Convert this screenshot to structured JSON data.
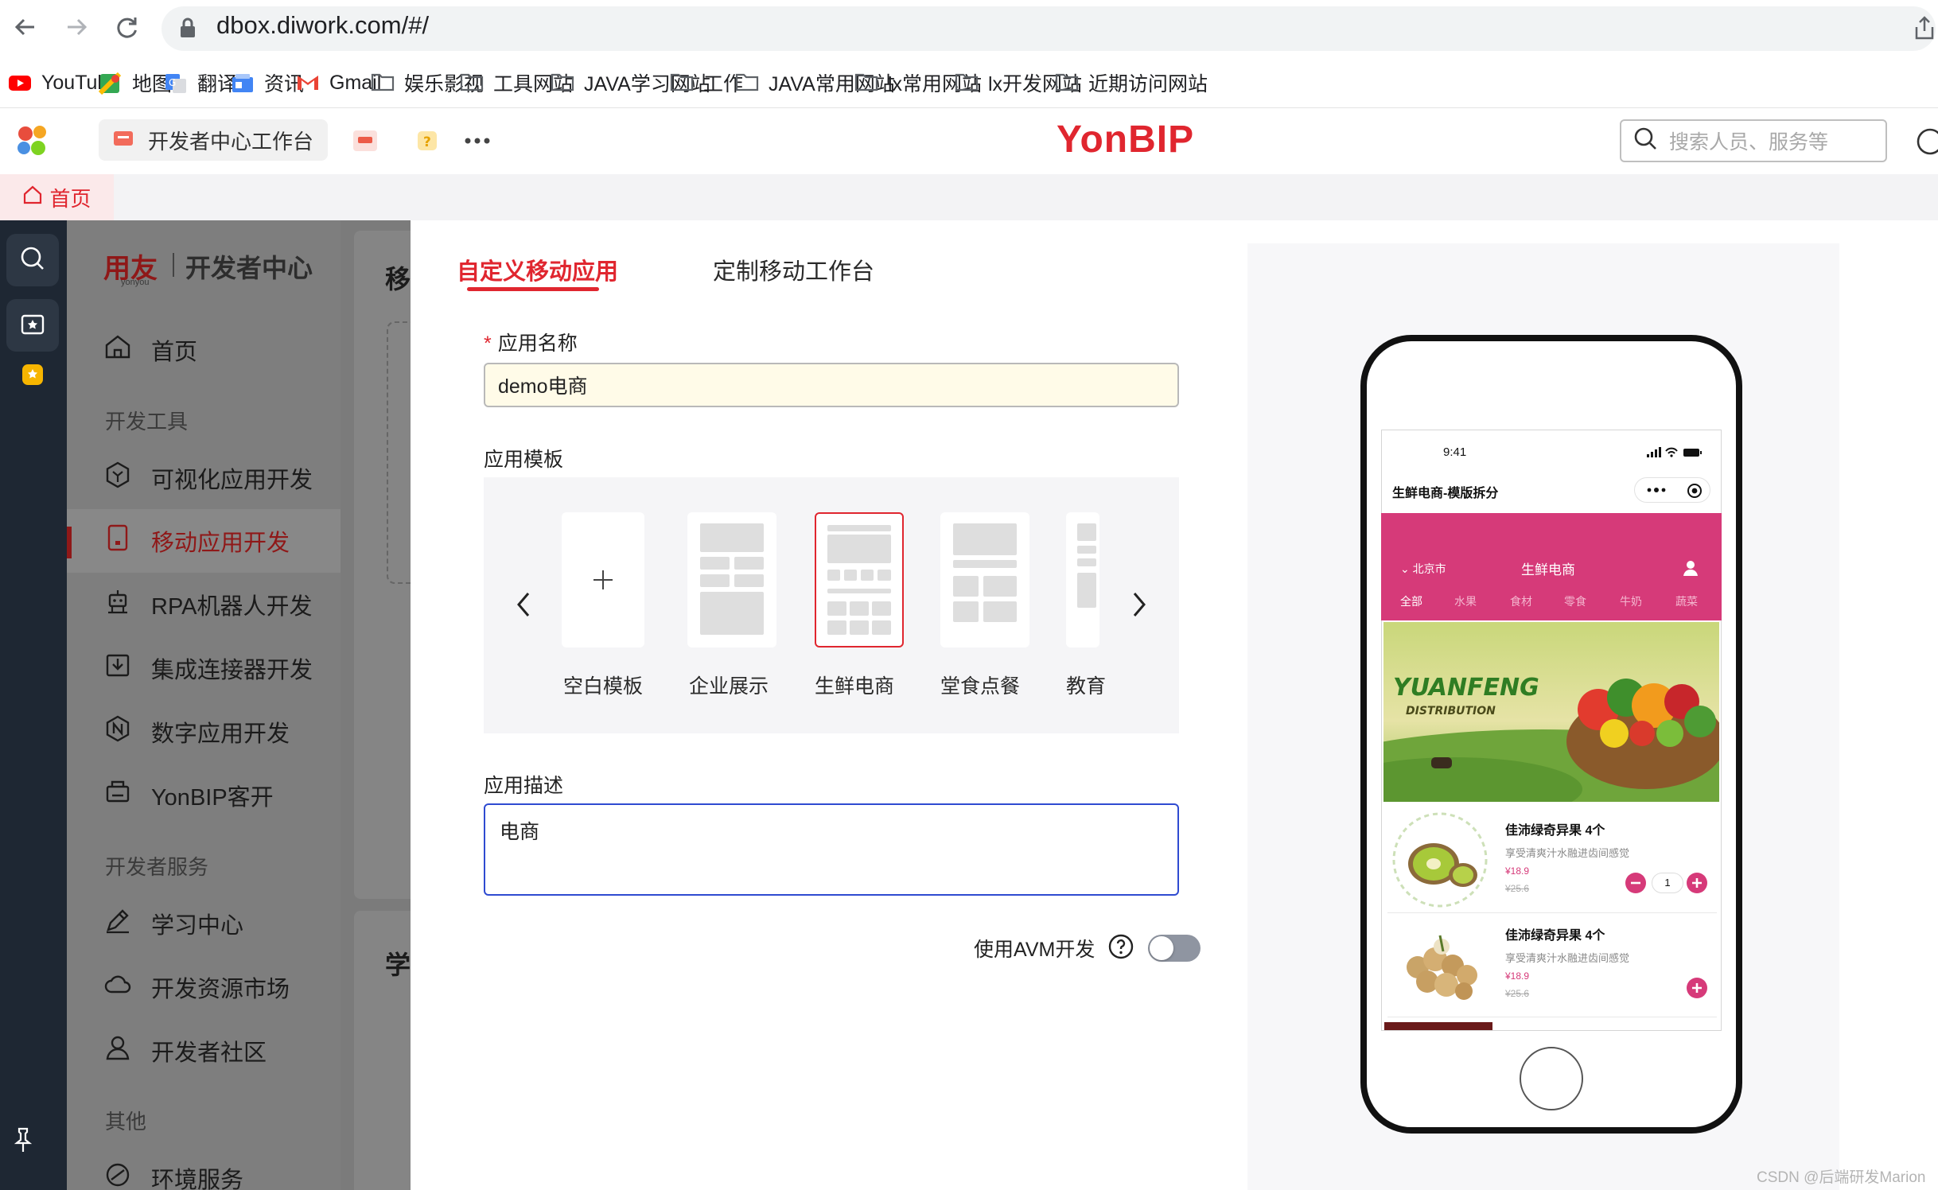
{
  "browser": {
    "url": "dbox.diwork.com/#/",
    "bookmarks": [
      "YouTube",
      "地图",
      "翻译",
      "资讯",
      "Gmail",
      "娱乐影视",
      "工具网站",
      "JAVA学习网站",
      "工作",
      "JAVA常用网站",
      "lx常用网站",
      "lx开发网站",
      "近期访问网站"
    ]
  },
  "app": {
    "workbench_tab": "开发者中心工作台",
    "brand": "YonBIP",
    "search_placeholder": "搜索人员、服务等",
    "home_tab": "首页"
  },
  "dev_sidebar": {
    "logo_main": "用友",
    "logo_sub": "yonyou",
    "logo_text": "开发者中心",
    "home": "首页",
    "group_tools": "开发工具",
    "tools": [
      "可视化应用开发",
      "移动应用开发",
      "RPA机器人开发",
      "集成连接器开发",
      "数字应用开发",
      "YonBIP客开"
    ],
    "group_services": "开发者服务",
    "services": [
      "学习中心",
      "开发资源市场",
      "开发者社区"
    ],
    "group_other": "其他",
    "other": [
      "环境服务"
    ],
    "active_item": "移动应用开发"
  },
  "middle": {
    "heading1": "移",
    "heading2": "学"
  },
  "drawer": {
    "tabs": [
      "自定义移动应用",
      "定制移动工作台"
    ],
    "active_tab": "自定义移动应用",
    "app_name_label": "应用名称",
    "app_name_value": "demo电商",
    "template_label": "应用模板",
    "templates": [
      "空白模板",
      "企业展示",
      "生鲜电商",
      "堂食点餐",
      "教育"
    ],
    "selected_template": "生鲜电商",
    "desc_label": "应用描述",
    "desc_value": "电商",
    "avm_label": "使用AVM开发",
    "avm_enabled": false
  },
  "phone": {
    "time": "9:41",
    "mini_title": "生鲜电商-模版拆分",
    "city": "北京市",
    "store_title": "生鲜电商",
    "categories": [
      "全部",
      "水果",
      "食材",
      "零食",
      "牛奶",
      "蔬菜"
    ],
    "banner_title": "YUANFENG",
    "banner_subtitle": "DISTRIBUTION",
    "products": [
      {
        "name": "佳沛绿奇异果 4个",
        "desc": "享受清爽汁水融进齿间感觉",
        "price": "¥18.9",
        "old_price": "¥25.6",
        "qty": "1"
      },
      {
        "name": "佳沛绿奇异果 4个",
        "desc": "享受清爽汁水融进齿间感觉",
        "price": "¥18.9",
        "old_price": "¥25.6"
      }
    ],
    "accent": "#d63a79"
  },
  "watermark": "CSDN @后端研发Marion"
}
